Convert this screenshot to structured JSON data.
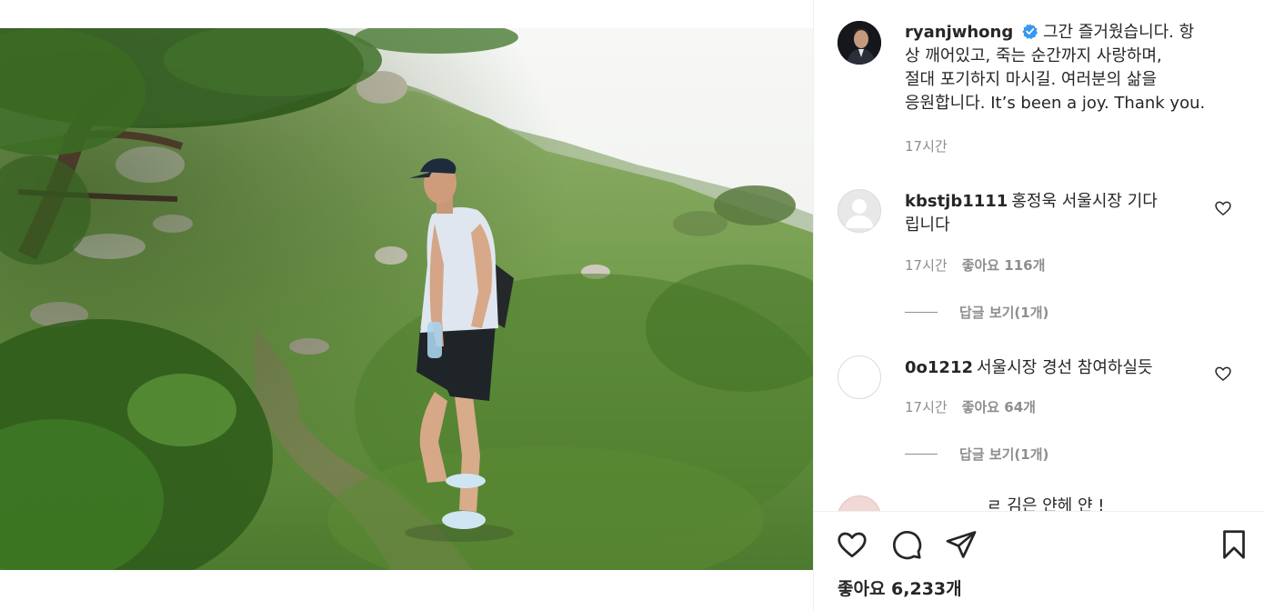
{
  "post": {
    "username": "ryanjwhong",
    "caption": "그간 즐거웠습니다. 항상 깨어있고, 죽는 순간까지 사랑하며, 절대 포기하지 마시길. 여러분의 삶을 응원합니다. It’s been a joy. Thank you.",
    "caption_lines": [
      "그간 즐거웠습니다. 항",
      "상 깨어있고, 죽는 순간까지 사랑하며,",
      "절대 포기하지 마시길. 여러분의 삶을",
      "응원합니다. It’s been a joy. Thank you."
    ],
    "time": "17시간",
    "verified": true
  },
  "comments": [
    {
      "username": "kbstjb1111",
      "text_lines": [
        "홍정욱 서울시장 기다",
        "립니다"
      ],
      "time": "17시간",
      "likes": "좋아요 116개",
      "replies": "답글 보기(1개)"
    },
    {
      "username": "0o1212",
      "text_lines": [
        "서울시장 경선 참여하실듯"
      ],
      "time": "17시간",
      "likes": "좋아요 64개",
      "replies": "답글 보기(1개)"
    }
  ],
  "partial_comment": {
    "text": "ㄹ 김은 얀헤 얀 !"
  },
  "actions": {
    "like_icon": "heart-icon",
    "comment_icon": "comment-icon",
    "share_icon": "paper-plane-icon",
    "save_icon": "bookmark-icon"
  },
  "likes_total": "좋아요 6,233개",
  "colors": {
    "text": "#262626",
    "secondary": "#8e8e8e",
    "verified": "#3897f0",
    "border": "#efefef"
  }
}
